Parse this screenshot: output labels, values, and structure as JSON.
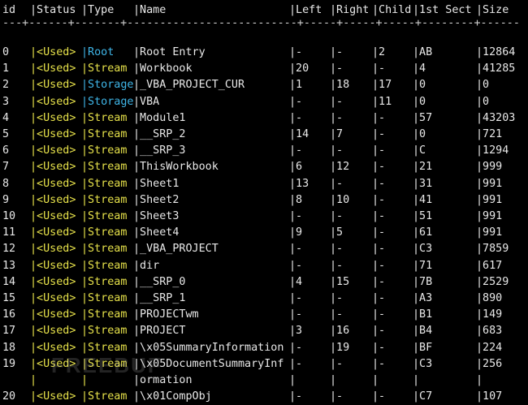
{
  "header": {
    "id": "id",
    "status": "|Status",
    "type": "|Type",
    "name": "|Name",
    "left": "|Left",
    "right": "|Right",
    "child": "|Child",
    "sect": "|1st Sect",
    "size": "|Size"
  },
  "divider": "---+------+-------+--------------------------+-----+-----+-----+--------+------",
  "rows": [
    {
      "id": "0",
      "status": "|<Used>",
      "type": "|Root",
      "type_class": "root",
      "name": "|Root Entry",
      "left": "|-",
      "right": "|-",
      "child": "|2",
      "sect": "|AB",
      "size": "|12864"
    },
    {
      "id": "1",
      "status": "|<Used>",
      "type": "|Stream",
      "type_class": "stream",
      "name": "|Workbook",
      "left": "|20",
      "right": "|-",
      "child": "|-",
      "sect": "|4",
      "size": "|41285"
    },
    {
      "id": "2",
      "status": "|<Used>",
      "type": "|Storage",
      "type_class": "storage",
      "name": "|_VBA_PROJECT_CUR",
      "left": "|1",
      "right": "|18",
      "child": "|17",
      "sect": "|0",
      "size": "|0"
    },
    {
      "id": "3",
      "status": "|<Used>",
      "type": "|Storage",
      "type_class": "storage",
      "name": "|VBA",
      "left": "|-",
      "right": "|-",
      "child": "|11",
      "sect": "|0",
      "size": "|0"
    },
    {
      "id": "4",
      "status": "|<Used>",
      "type": "|Stream",
      "type_class": "stream",
      "name": "|Module1",
      "left": "|-",
      "right": "|-",
      "child": "|-",
      "sect": "|57",
      "size": "|43203"
    },
    {
      "id": "5",
      "status": "|<Used>",
      "type": "|Stream",
      "type_class": "stream",
      "name": "|__SRP_2",
      "left": "|14",
      "right": "|7",
      "child": "|-",
      "sect": "|0",
      "size": "|721"
    },
    {
      "id": "6",
      "status": "|<Used>",
      "type": "|Stream",
      "type_class": "stream",
      "name": "|__SRP_3",
      "left": "|-",
      "right": "|-",
      "child": "|-",
      "sect": "|C",
      "size": "|1294"
    },
    {
      "id": "7",
      "status": "|<Used>",
      "type": "|Stream",
      "type_class": "stream",
      "name": "|ThisWorkbook",
      "left": "|6",
      "right": "|12",
      "child": "|-",
      "sect": "|21",
      "size": "|999"
    },
    {
      "id": "8",
      "status": "|<Used>",
      "type": "|Stream",
      "type_class": "stream",
      "name": "|Sheet1",
      "left": "|13",
      "right": "|-",
      "child": "|-",
      "sect": "|31",
      "size": "|991"
    },
    {
      "id": "9",
      "status": "|<Used>",
      "type": "|Stream",
      "type_class": "stream",
      "name": "|Sheet2",
      "left": "|8",
      "right": "|10",
      "child": "|-",
      "sect": "|41",
      "size": "|991"
    },
    {
      "id": "10",
      "status": "|<Used>",
      "type": "|Stream",
      "type_class": "stream",
      "name": "|Sheet3",
      "left": "|-",
      "right": "|-",
      "child": "|-",
      "sect": "|51",
      "size": "|991"
    },
    {
      "id": "11",
      "status": "|<Used>",
      "type": "|Stream",
      "type_class": "stream",
      "name": "|Sheet4",
      "left": "|9",
      "right": "|5",
      "child": "|-",
      "sect": "|61",
      "size": "|991"
    },
    {
      "id": "12",
      "status": "|<Used>",
      "type": "|Stream",
      "type_class": "stream",
      "name": "|_VBA_PROJECT",
      "left": "|-",
      "right": "|-",
      "child": "|-",
      "sect": "|C3",
      "size": "|7859"
    },
    {
      "id": "13",
      "status": "|<Used>",
      "type": "|Stream",
      "type_class": "stream",
      "name": "|dir",
      "left": "|-",
      "right": "|-",
      "child": "|-",
      "sect": "|71",
      "size": "|617"
    },
    {
      "id": "14",
      "status": "|<Used>",
      "type": "|Stream",
      "type_class": "stream",
      "name": "|__SRP_0",
      "left": "|4",
      "right": "|15",
      "child": "|-",
      "sect": "|7B",
      "size": "|2529"
    },
    {
      "id": "15",
      "status": "|<Used>",
      "type": "|Stream",
      "type_class": "stream",
      "name": "|__SRP_1",
      "left": "|-",
      "right": "|-",
      "child": "|-",
      "sect": "|A3",
      "size": "|890"
    },
    {
      "id": "16",
      "status": "|<Used>",
      "type": "|Stream",
      "type_class": "stream",
      "name": "|PROJECTwm",
      "left": "|-",
      "right": "|-",
      "child": "|-",
      "sect": "|B1",
      "size": "|149"
    },
    {
      "id": "17",
      "status": "|<Used>",
      "type": "|Stream",
      "type_class": "stream",
      "name": "|PROJECT",
      "left": "|3",
      "right": "|16",
      "child": "|-",
      "sect": "|B4",
      "size": "|683"
    },
    {
      "id": "18",
      "status": "|<Used>",
      "type": "|Stream",
      "type_class": "stream",
      "name": "|\\x05SummaryInformation",
      "left": "|-",
      "right": "|19",
      "child": "|-",
      "sect": "|BF",
      "size": "|224"
    },
    {
      "id": "19",
      "status": "|<Used>",
      "type": "|Stream",
      "type_class": "stream",
      "name": "|\\x05DocumentSummaryInf",
      "left": "|-",
      "right": "|-",
      "child": "|-",
      "sect": "|C3",
      "size": "|256"
    },
    {
      "id": "",
      "status": "|",
      "type": "|",
      "type_class": "stream",
      "name": "|ormation",
      "left": "|",
      "right": "|",
      "child": "|",
      "sect": "|",
      "size": "|"
    },
    {
      "id": "20",
      "status": "|<Used>",
      "type": "|Stream",
      "type_class": "stream",
      "name": "|\\x01CompObj",
      "left": "|-",
      "right": "|-",
      "child": "|-",
      "sect": "|C7",
      "size": "|107"
    }
  ],
  "colors": {
    "background": "#000000",
    "text": "#e8e8e8",
    "status_yellow": "#e6e14a",
    "storage_cyan": "#3fb6e8"
  },
  "watermark": "FREEBUF"
}
